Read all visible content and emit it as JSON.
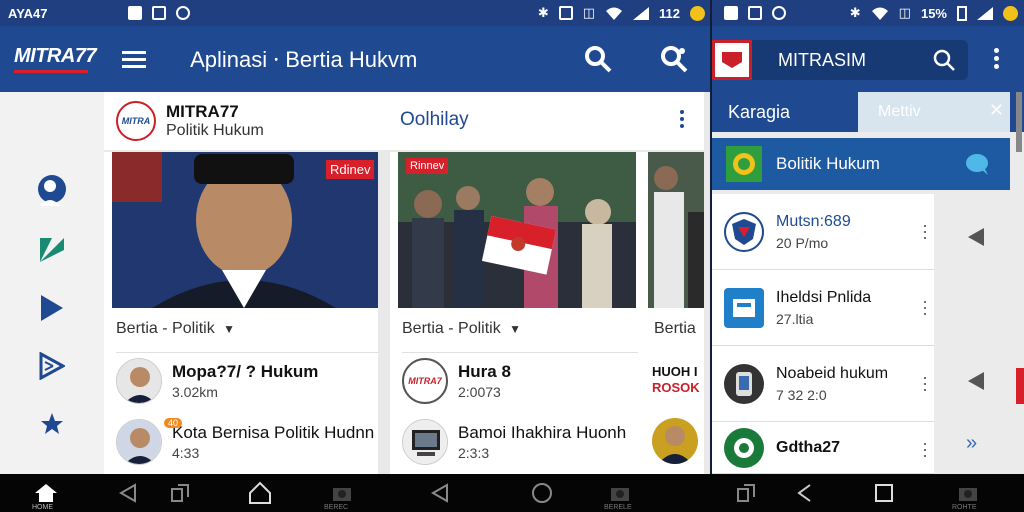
{
  "status_left": {
    "carrier": "AYA47",
    "battery": "112"
  },
  "status_right": {
    "battery": "15%"
  },
  "left_app": {
    "logo": "MITRA77",
    "title": "Aplinasi ⸱ Bertia Hukvm"
  },
  "channel": {
    "name": "MITRA77",
    "subtitle": "Politik Hukum",
    "link": "Oolhilay",
    "avatar_text": "MITRA"
  },
  "cards": [
    {
      "badge": "Rdinev",
      "category": "Bertia - Politik",
      "rows": [
        {
          "title": "Mopa?7/ ? Hukum",
          "meta": "3.02km"
        },
        {
          "title": "Kota Bernisa Politik Hudnn",
          "meta": "4:33",
          "tag": "40"
        }
      ]
    },
    {
      "badge": "Rinnev",
      "category": "Bertia - Politik",
      "rows": [
        {
          "title": "Hura 8",
          "meta": "2:0073",
          "thumb_text": "MITRA7"
        },
        {
          "title": "Bamoi Ihakhira Huonh",
          "meta": "2:3:3"
        }
      ]
    },
    {
      "category": "Bertia",
      "rows": [
        {
          "title": "HUOH I",
          "sub": "ROSOK"
        }
      ]
    }
  ],
  "right_app": {
    "title": "MITRASIM",
    "tab": "Karagia",
    "chip": "Mettiv",
    "highlight": "Bolitik Hukum",
    "items": [
      {
        "title": "Mutsn:689",
        "meta": "20 P/mo"
      },
      {
        "title": "Iheldsi Pnlida",
        "meta": "27.ltia"
      },
      {
        "title": "Noabeid hukum",
        "meta": "7 32 2:0"
      },
      {
        "title": "Gdtha27",
        "meta": ""
      }
    ]
  },
  "navbar": {
    "home_label": "HOME",
    "label_1": "BEREC",
    "label_2": "BERELE",
    "label_3": "ROHTE"
  },
  "colors": {
    "brand": "#1f4a92",
    "status": "#1f3f80",
    "accent": "#c9202a",
    "rail_icon": "#1f4a92"
  }
}
